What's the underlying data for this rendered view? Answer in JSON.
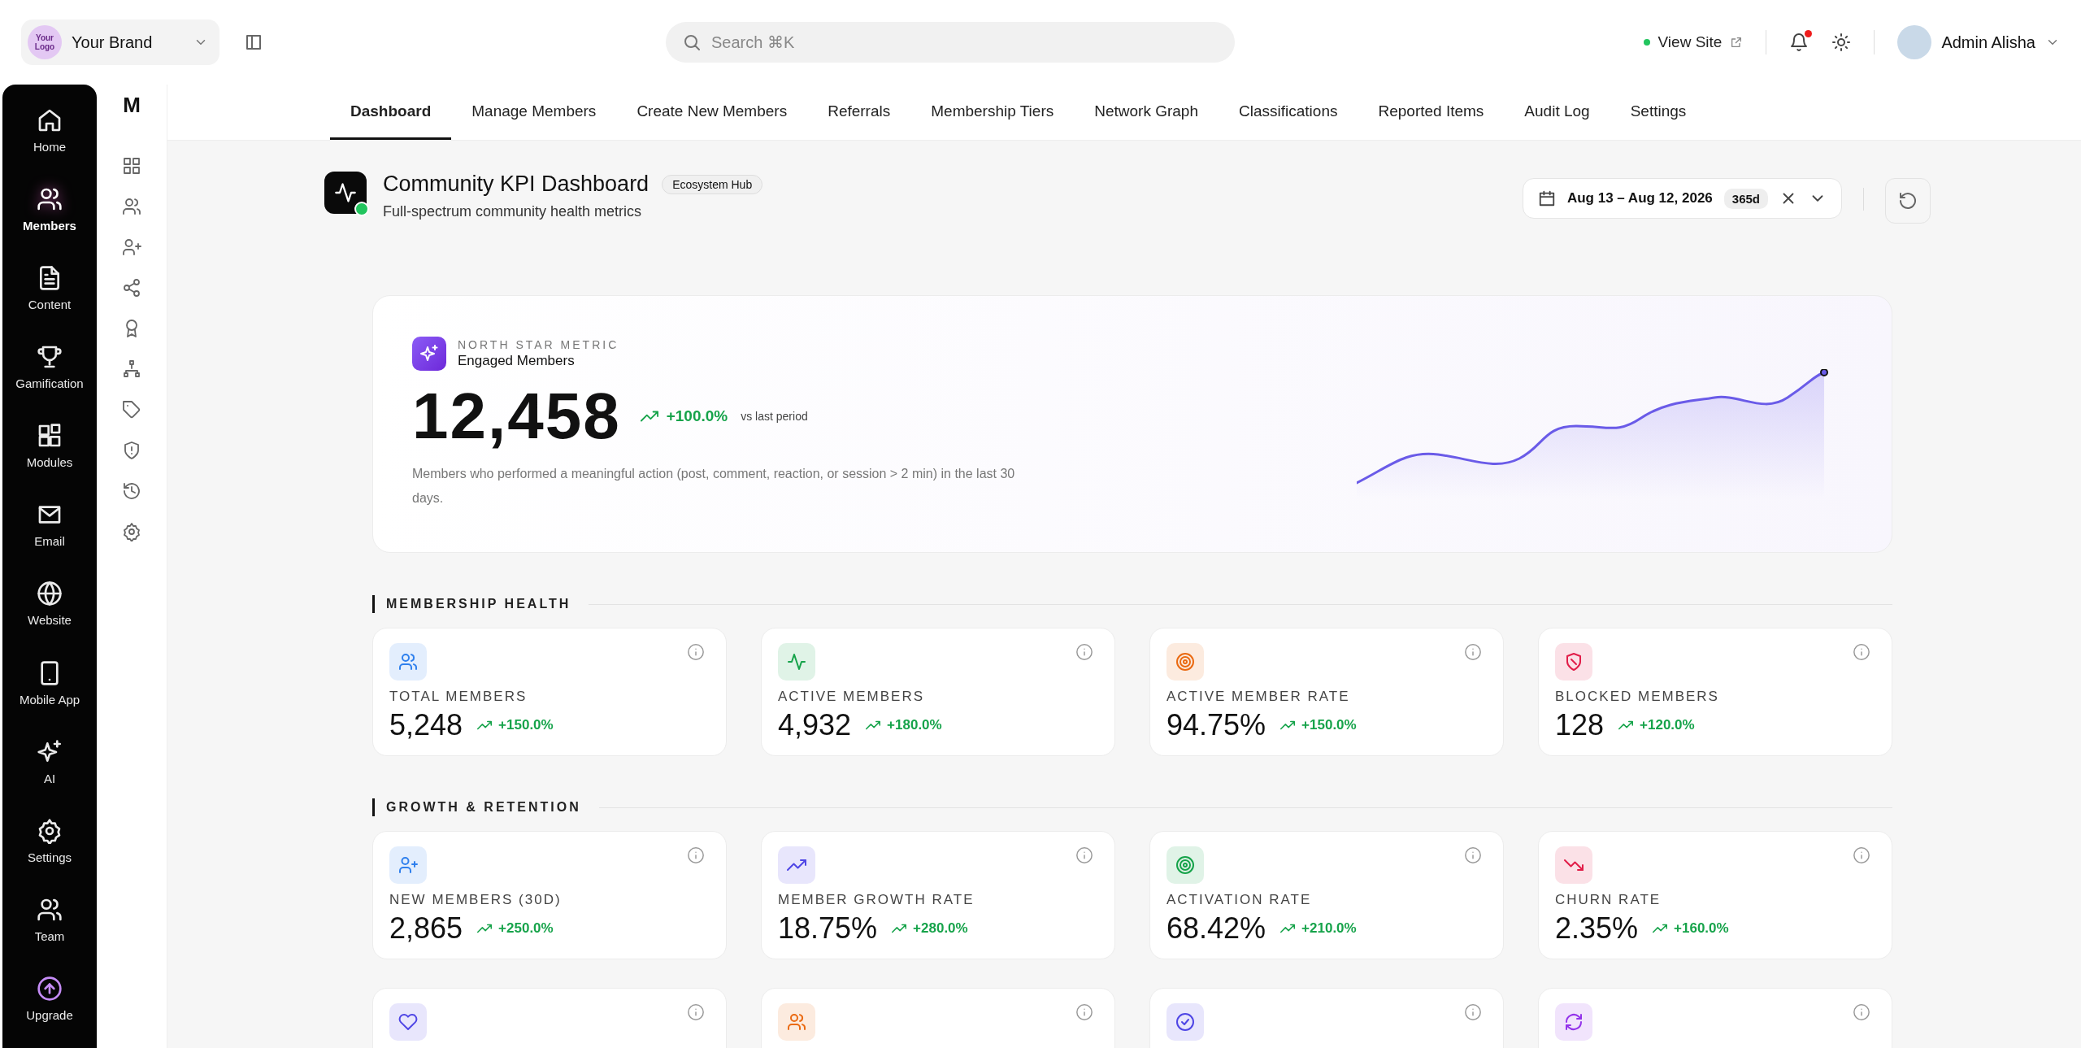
{
  "top_bar": {
    "brand": {
      "logo_text": "Your Logo",
      "name": "Your Brand"
    },
    "search": {
      "placeholder": "Search ⌘K"
    },
    "view_site": "View Site",
    "notifications": {
      "unread": true
    },
    "user": {
      "name": "Admin Alisha"
    }
  },
  "sidebar": {
    "items": [
      {
        "kind": "home",
        "label": "Home",
        "selected": false
      },
      {
        "kind": "users",
        "label": "Members",
        "selected": true
      },
      {
        "kind": "file",
        "label": "Content",
        "selected": false
      },
      {
        "kind": "trophy",
        "label": "Gamification",
        "selected": false
      },
      {
        "kind": "modules",
        "label": "Modules",
        "selected": false
      },
      {
        "kind": "mail",
        "label": "Email",
        "selected": false
      },
      {
        "kind": "globe",
        "label": "Website",
        "selected": false
      },
      {
        "kind": "phone",
        "label": "Mobile App",
        "selected": false
      },
      {
        "kind": "sparkle",
        "label": "AI",
        "selected": false
      },
      {
        "kind": "gear",
        "label": "Settings",
        "selected": false
      },
      {
        "kind": "users",
        "label": "Team",
        "selected": false
      },
      {
        "kind": "upgrade",
        "label": "Upgrade",
        "selected": false
      }
    ]
  },
  "rail": {
    "title": "M",
    "icons": [
      {
        "kind": "grid"
      },
      {
        "kind": "users"
      },
      {
        "kind": "user-plus"
      },
      {
        "kind": "share"
      },
      {
        "kind": "award"
      },
      {
        "kind": "hierarchy"
      },
      {
        "kind": "tag"
      },
      {
        "kind": "shield-alert"
      },
      {
        "kind": "history"
      },
      {
        "kind": "gear"
      }
    ]
  },
  "tabs": [
    {
      "label": "Dashboard",
      "selected": true
    },
    {
      "label": "Manage Members",
      "selected": false
    },
    {
      "label": "Create New Members",
      "selected": false
    },
    {
      "label": "Referrals",
      "selected": false
    },
    {
      "label": "Membership Tiers",
      "selected": false
    },
    {
      "label": "Network Graph",
      "selected": false
    },
    {
      "label": "Classifications",
      "selected": false
    },
    {
      "label": "Reported Items",
      "selected": false
    },
    {
      "label": "Audit Log",
      "selected": false
    },
    {
      "label": "Settings",
      "selected": false
    }
  ],
  "header": {
    "title": "Community KPI Dashboard",
    "tag": "Ecosystem Hub",
    "subtitle": "Full-spectrum community health metrics",
    "date_range": "Aug 13 – Aug 12, 2026",
    "range_days": "365d"
  },
  "north_star": {
    "eyebrow": "NORTH STAR METRIC",
    "name": "Engaged Members",
    "value": "12,458",
    "change": "+100.0%",
    "comparison": "vs last period",
    "description": "Members who performed a meaningful action (post, comment, reaction, or session > 2 min) in the last 30 days."
  },
  "sections": [
    {
      "title": "MEMBERSHIP HEALTH",
      "cards": [
        {
          "kind": "users",
          "color": "#2f80ed",
          "label": "TOTAL MEMBERS",
          "value": "5,248",
          "change": "+150.0%"
        },
        {
          "kind": "pulse",
          "color": "#16a34a",
          "label": "ACTIVE MEMBERS",
          "value": "4,932",
          "change": "+180.0%"
        },
        {
          "kind": "target",
          "color": "#ea6a12",
          "label": "ACTIVE MEMBER RATE",
          "value": "94.75%",
          "change": "+150.0%"
        },
        {
          "kind": "shield-x",
          "color": "#e11d48",
          "label": "BLOCKED MEMBERS",
          "value": "128",
          "change": "+120.0%"
        }
      ]
    },
    {
      "title": "GROWTH & RETENTION",
      "cards": [
        {
          "kind": "user-plus",
          "color": "#2f80ed",
          "label": "NEW MEMBERS (30D)",
          "value": "2,865",
          "change": "+250.0%"
        },
        {
          "kind": "trend-up",
          "color": "#4f46e5",
          "label": "MEMBER GROWTH RATE",
          "value": "18.75%",
          "change": "+280.0%"
        },
        {
          "kind": "target",
          "color": "#16a34a",
          "label": "ACTIVATION RATE",
          "value": "68.42%",
          "change": "+210.0%"
        },
        {
          "kind": "trend-down",
          "color": "#e11d48",
          "label": "CHURN RATE",
          "value": "2.35%",
          "change": "+160.0%"
        },
        {
          "kind": "heart",
          "color": "#4f46e5"
        },
        {
          "kind": "users",
          "color": "#ea6a12"
        },
        {
          "kind": "check-circle",
          "color": "#4f46e5"
        },
        {
          "kind": "refresh",
          "color": "#9333ea"
        }
      ]
    }
  ]
}
